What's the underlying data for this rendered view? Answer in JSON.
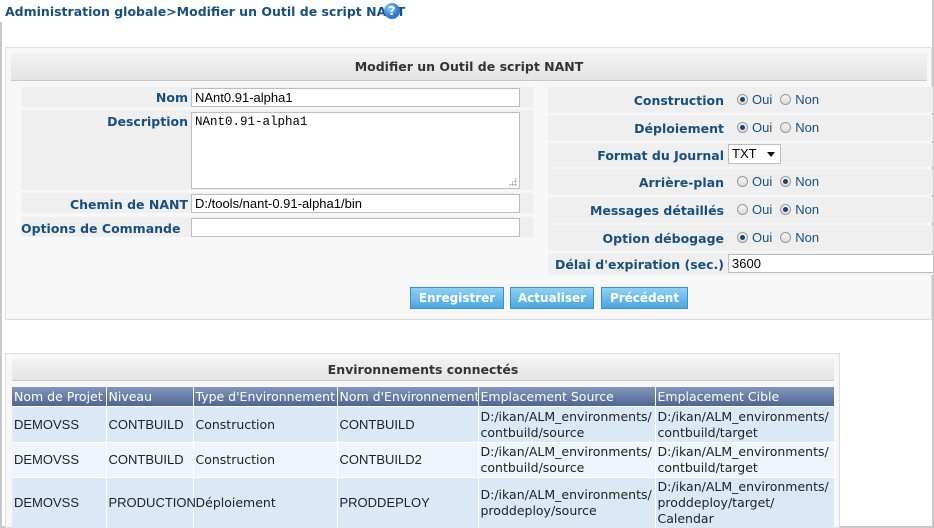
{
  "header": {
    "breadcrumb": "Administration globale>Modifier un Outil de script NANT",
    "help_icon": "?"
  },
  "form": {
    "title": "Modifier un Outil de script NANT",
    "left": {
      "nom_label": "Nom",
      "nom_value": "NAnt0.91-alpha1",
      "description_label": "Description",
      "description_value": "NAnt0.91-alpha1",
      "chemin_label": "Chemin de NANT",
      "chemin_value": "D:/tools/nant-0.91-alpha1/bin",
      "options_label": "Options de Commande",
      "options_value": ""
    },
    "right": {
      "construction": {
        "label": "Construction",
        "selected": "Oui"
      },
      "deploiement": {
        "label": "Déploiement",
        "selected": "Oui"
      },
      "format": {
        "label": "Format du Journal",
        "value": "TXT"
      },
      "arriere_plan": {
        "label": "Arrière-plan",
        "selected": "Non"
      },
      "messages": {
        "label": "Messages détaillés",
        "selected": "Non"
      },
      "debogage": {
        "label": "Option débogage",
        "selected": "Oui"
      },
      "delai": {
        "label": "Délai d'expiration (sec.)",
        "value": "3600"
      }
    },
    "radio_labels": {
      "yes": "Oui",
      "no": "Non"
    },
    "buttons": {
      "save": "Enregistrer",
      "refresh": "Actualiser",
      "back": "Précédent"
    }
  },
  "environments": {
    "title": "Environnements connectés",
    "columns": [
      "Nom de Projet",
      "Niveau",
      "Type d'Environnement",
      "Nom d'Environnement",
      "Emplacement Source",
      "Emplacement Cible"
    ],
    "rows": [
      [
        "DEMOVSS",
        "CONTBUILD",
        "Construction",
        "CONTBUILD",
        "D:/ikan/ALM_environments/ contbuild/source",
        "D:/ikan/ALM_environments/ contbuild/target"
      ],
      [
        "DEMOVSS",
        "CONTBUILD",
        "Construction",
        "CONTBUILD2",
        "D:/ikan/ALM_environments/ contbuild/source",
        "D:/ikan/ALM_environments/ contbuild/target"
      ],
      [
        "DEMOVSS",
        "PRODUCTION",
        "Déploiement",
        "PRODDEPLOY",
        "D:/ikan/ALM_environments/ proddeploy/source",
        "D:/ikan/ALM_environments/ proddeploy/target/ Calendar"
      ]
    ]
  },
  "colors": {
    "label": "#17507e",
    "button": "#4aa7de",
    "table_header": "#5b72a0",
    "row_odd": "#dbe9f6",
    "row_even": "#eef4fb"
  }
}
